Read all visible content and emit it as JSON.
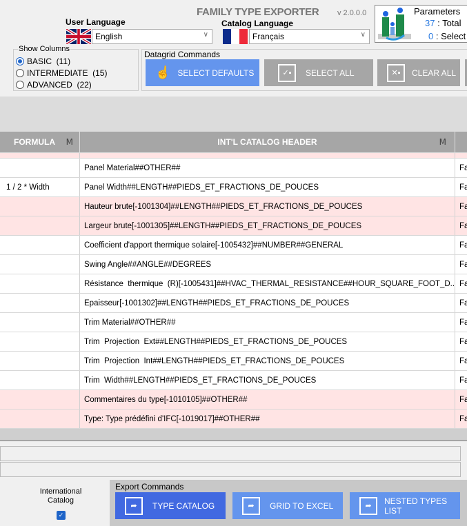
{
  "app": {
    "title": "FAMILY TYPE EXPORTER",
    "version": "v 2.0.0.0"
  },
  "user_language": {
    "label": "User Language",
    "value": "English"
  },
  "catalog_language": {
    "label": "Catalog Language",
    "value": "Français"
  },
  "parameters": {
    "title": "Parameters",
    "total": "37",
    "total_label": ": Total",
    "selected": "0",
    "selected_label": ": Select"
  },
  "show_columns": {
    "label": "Show Columns",
    "options": [
      {
        "label": "BASIC  (11)",
        "checked": true
      },
      {
        "label": "INTERMEDIATE  (15)",
        "checked": false
      },
      {
        "label": "ADVANCED  (22)",
        "checked": false
      }
    ]
  },
  "datagrid_commands": {
    "label": "Datagrid Commands",
    "select_defaults": "SELECT DEFAULTS",
    "select_all": "SELECT ALL",
    "clear_all": "CLEAR ALL"
  },
  "grid": {
    "headers": {
      "formula": "FORMULA",
      "intl": "INT'L CATALOG HEADER"
    },
    "rows": [
      {
        "formula": "",
        "intl": "Panel Material##OTHER##",
        "c3": "Fa",
        "pink": false
      },
      {
        "formula": "1 / 2 * Width",
        "intl": "Panel Width##LENGTH##PIEDS_ET_FRACTIONS_DE_POUCES",
        "c3": "Fa",
        "pink": false
      },
      {
        "formula": "",
        "intl": "Hauteur brute[-1001304]##LENGTH##PIEDS_ET_FRACTIONS_DE_POUCES",
        "c3": "Fa",
        "pink": true
      },
      {
        "formula": "",
        "intl": "Largeur brute[-1001305]##LENGTH##PIEDS_ET_FRACTIONS_DE_POUCES",
        "c3": "Fa",
        "pink": true
      },
      {
        "formula": "",
        "intl": "Coefficient d'apport thermique solaire[-1005432]##NUMBER##GENERAL",
        "c3": "Fa",
        "pink": false
      },
      {
        "formula": "",
        "intl": "Swing Angle##ANGLE##DEGREES",
        "c3": "Fa",
        "pink": false
      },
      {
        "formula": "",
        "intl": "Résistance  thermique  (R)[-1005431]##HVAC_THERMAL_RESISTANCE##HOUR_SQUARE_FOOT_D...",
        "c3": "Fa",
        "pink": false
      },
      {
        "formula": "",
        "intl": "Epaisseur[-1001302]##LENGTH##PIEDS_ET_FRACTIONS_DE_POUCES",
        "c3": "Fa",
        "pink": false
      },
      {
        "formula": "",
        "intl": "Trim Material##OTHER##",
        "c3": "Fa",
        "pink": false
      },
      {
        "formula": "",
        "intl": "Trim  Projection  Ext##LENGTH##PIEDS_ET_FRACTIONS_DE_POUCES",
        "c3": "Fa",
        "pink": false
      },
      {
        "formula": "",
        "intl": "Trim  Projection  Int##LENGTH##PIEDS_ET_FRACTIONS_DE_POUCES",
        "c3": "Fa",
        "pink": false
      },
      {
        "formula": "",
        "intl": "Trim  Width##LENGTH##PIEDS_ET_FRACTIONS_DE_POUCES",
        "c3": "Fa",
        "pink": false
      },
      {
        "formula": "",
        "intl": "Commentaires du type[-1010105]##OTHER##",
        "c3": "Fa",
        "pink": true
      },
      {
        "formula": "",
        "intl": "Type: Type prédéfini d'IFC[-1019017]##OTHER##",
        "c3": "Fa",
        "pink": true
      }
    ]
  },
  "international_catalog": {
    "label": "International Catalog",
    "checked": true
  },
  "export_commands": {
    "label": "Export Commands",
    "type_catalog": "TYPE CATALOG",
    "grid_to_excel": "GRID TO EXCEL",
    "nested_types": "NESTED TYPES LIST"
  }
}
